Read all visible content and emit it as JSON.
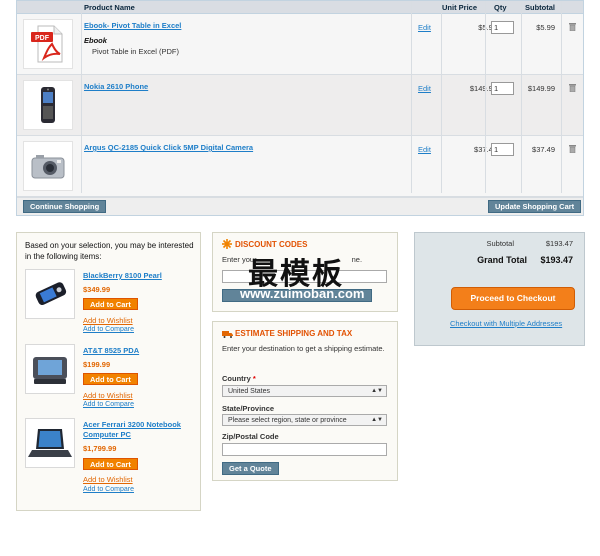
{
  "cart": {
    "headers": {
      "product_name": "Product Name",
      "unit_price": "Unit Price",
      "qty": "Qty",
      "subtotal": "Subtotal"
    },
    "edit_label": "Edit",
    "items": [
      {
        "name": "Ebook- Pivot Table in Excel",
        "option_label": "Ebook",
        "option_value": "Pivot Table in Excel (PDF)",
        "unit_price": "$5.99",
        "qty": "1",
        "subtotal": "$5.99",
        "icon": "pdf-icon"
      },
      {
        "name": "Nokia 2610 Phone",
        "unit_price": "$149.99",
        "qty": "1",
        "subtotal": "$149.99",
        "icon": "phone-icon"
      },
      {
        "name": "Argus QC-2185 Quick Click 5MP Digital Camera",
        "unit_price": "$37.49",
        "qty": "1",
        "subtotal": "$37.49",
        "icon": "camera-icon"
      }
    ],
    "continue_label": "Continue Shopping",
    "update_label": "Update Shopping Cart"
  },
  "crosssell": {
    "intro": "Based on your selection, you may be interested in the following items:",
    "add_to_cart": "Add to Cart",
    "add_to_wishlist": "Add to Wishlist",
    "add_to_compare": "Add to Compare",
    "items": [
      {
        "name": "BlackBerry 8100 Pearl",
        "price": "$349.99"
      },
      {
        "name": "AT&T 8525 PDA",
        "price": "$199.99"
      },
      {
        "name": "Acer Ferrari 3200 Notebook Computer PC",
        "price": "$1,799.99"
      }
    ]
  },
  "discount": {
    "title": "DISCOUNT CODES",
    "text_a": "Enter your",
    "text_b": "ne.",
    "button": "Apply Coupon"
  },
  "shipping": {
    "title": "ESTIMATE SHIPPING AND TAX",
    "text": "Enter your destination to get a shipping estimate.",
    "country_label": "Country",
    "required_mark": "*",
    "country_value": "United States",
    "state_label": "State/Province",
    "state_value": "Please select region, state or province",
    "zip_label": "Zip/Postal Code",
    "quote_button": "Get a Quote"
  },
  "totals": {
    "subtotal_label": "Subtotal",
    "subtotal_value": "$193.47",
    "grand_label": "Grand Total",
    "grand_value": "$193.47",
    "checkout_button": "Proceed to Checkout",
    "multi_link": "Checkout with Multiple Addresses"
  },
  "watermark": {
    "cn": "最模板",
    "url": "www.zuimoban.com"
  }
}
